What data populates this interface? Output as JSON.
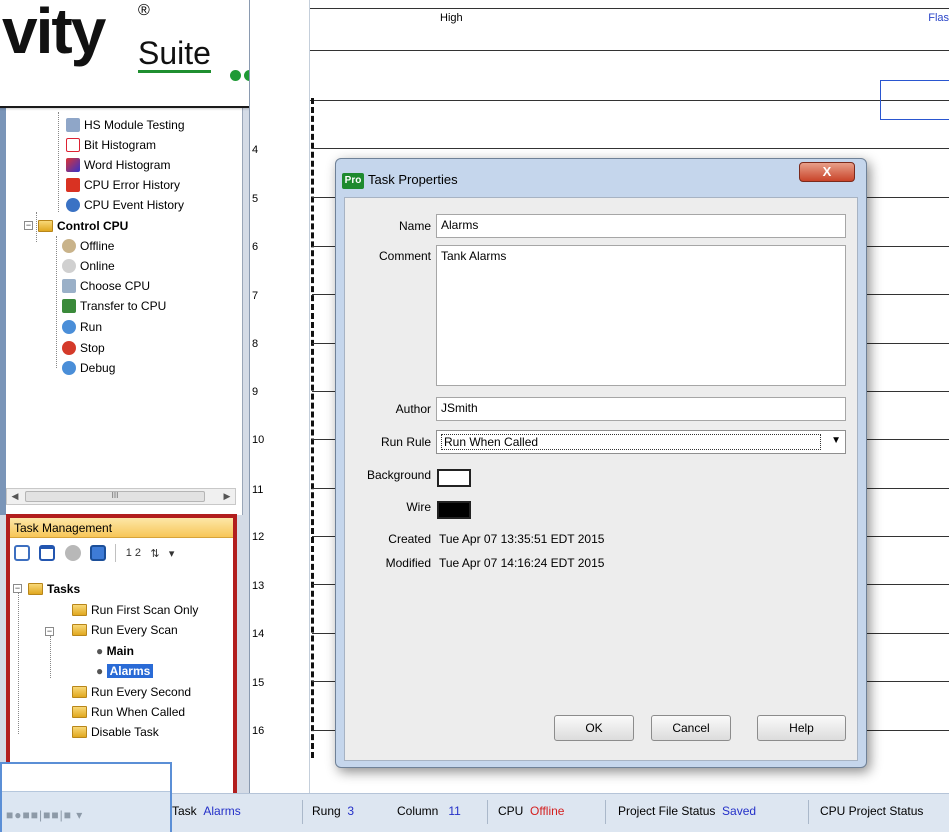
{
  "logo": {
    "brand_text": "vity",
    "suite_text": "Suite",
    "registered": "®"
  },
  "tree": {
    "items": [
      {
        "label": "HS Module Testing"
      },
      {
        "label": "Bit Histogram"
      },
      {
        "label": "Word Histogram"
      },
      {
        "label": "CPU Error History"
      },
      {
        "label": "CPU Event History"
      },
      {
        "label": "Control CPU"
      },
      {
        "label": "Offline"
      },
      {
        "label": "Online"
      },
      {
        "label": "Choose CPU"
      },
      {
        "label": "Transfer to CPU"
      },
      {
        "label": "Run"
      },
      {
        "label": "Stop"
      },
      {
        "label": "Debug"
      }
    ],
    "scroll_thumb": "III"
  },
  "task_panel": {
    "title": "Task Management",
    "toolbar_number": "1 2",
    "items": [
      {
        "label": "Tasks"
      },
      {
        "label": "Run First Scan Only"
      },
      {
        "label": "Run Every Scan"
      },
      {
        "label": "Main"
      },
      {
        "label": "Alarms"
      },
      {
        "label": "Run Every Second"
      },
      {
        "label": "Run When Called"
      },
      {
        "label": "Disable Task"
      }
    ]
  },
  "ladder": {
    "header_left": "High",
    "header_right": "Flas",
    "rungs": [
      "4",
      "5",
      "6",
      "7",
      "8",
      "9",
      "10",
      "11",
      "12",
      "13",
      "14",
      "15",
      "16"
    ]
  },
  "statusbar": {
    "task_label": "Task",
    "task_value": "Alarms",
    "rung_label": "Rung",
    "rung_value": "3",
    "column_label": "Column",
    "column_value": "11",
    "cpu_label": "CPU",
    "cpu_value": "Offline",
    "file_status_label": "Project File Status",
    "file_status_value": "Saved",
    "cpu_project_label": "CPU Project Status"
  },
  "dialog": {
    "badge": "Pro",
    "title": "Task Properties",
    "close": "X",
    "name_label": "Name",
    "name_value": "Alarms",
    "comment_label": "Comment",
    "comment_value": "Tank Alarms",
    "author_label": "Author",
    "author_value": "JSmith",
    "run_rule_label": "Run Rule",
    "run_rule_value": "Run When Called",
    "background_label": "Background",
    "wire_label": "Wire",
    "created_label": "Created",
    "created_value": "Tue Apr 07 13:35:51 EDT 2015",
    "modified_label": "Modified",
    "modified_value": "Tue Apr 07 14:16:24 EDT 2015",
    "ok_label": "OK",
    "cancel_label": "Cancel",
    "help_label": "Help",
    "colors": {
      "background": "#ffffff",
      "wire": "#000000"
    }
  }
}
